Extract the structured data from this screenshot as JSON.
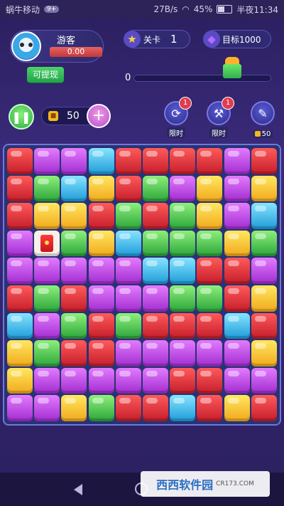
{
  "status_bar": {
    "carrier": "蜗牛移动",
    "carrier_badge": "9+",
    "speed": "27B/s",
    "battery": "45%",
    "time": "半夜11:34"
  },
  "player": {
    "name": "游客",
    "cash": "0.00",
    "withdraw_label": "可提现"
  },
  "level": {
    "label": "关卡",
    "value": "1"
  },
  "target": {
    "label": "目标1000"
  },
  "progress": {
    "score": "0",
    "fraction": 0
  },
  "coins": {
    "value": "50"
  },
  "boosters": [
    {
      "name": "refresh",
      "label": "限时",
      "badge": "1"
    },
    {
      "name": "hammer",
      "label": "限时",
      "badge": "1"
    },
    {
      "name": "brush",
      "label": "50"
    }
  ],
  "board": {
    "rows": [
      [
        "red",
        "purple",
        "purple",
        "blue",
        "red",
        "red",
        "red",
        "red",
        "purple",
        "red"
      ],
      [
        "red",
        "green",
        "blue",
        "yellow",
        "red",
        "green",
        "purple",
        "yellow",
        "purple",
        "yellow"
      ],
      [
        "red",
        "yellow",
        "yellow",
        "red",
        "green",
        "red",
        "green",
        "yellow",
        "purple",
        "blue"
      ],
      [
        "purple",
        "redpacket",
        "green",
        "yellow",
        "blue",
        "green",
        "green",
        "green",
        "yellow",
        "green"
      ],
      [
        "purple",
        "purple",
        "purple",
        "purple",
        "purple",
        "blue",
        "blue",
        "red",
        "red",
        "purple"
      ],
      [
        "red",
        "green",
        "red",
        "purple",
        "purple",
        "purple",
        "green",
        "green",
        "red",
        "yellow"
      ],
      [
        "blue",
        "purple",
        "green",
        "red",
        "green",
        "red",
        "red",
        "red",
        "blue",
        "red"
      ],
      [
        "yellow",
        "green",
        "red",
        "red",
        "purple",
        "purple",
        "purple",
        "purple",
        "purple",
        "yellow"
      ],
      [
        "yellow",
        "purple",
        "purple",
        "purple",
        "purple",
        "purple",
        "red",
        "red",
        "purple",
        "purple"
      ],
      [
        "purple",
        "purple",
        "yellow",
        "green",
        "red",
        "red",
        "blue",
        "red",
        "yellow",
        "red"
      ]
    ]
  },
  "watermark": {
    "text": "西西软件园",
    "sub": "CR173.COM"
  }
}
